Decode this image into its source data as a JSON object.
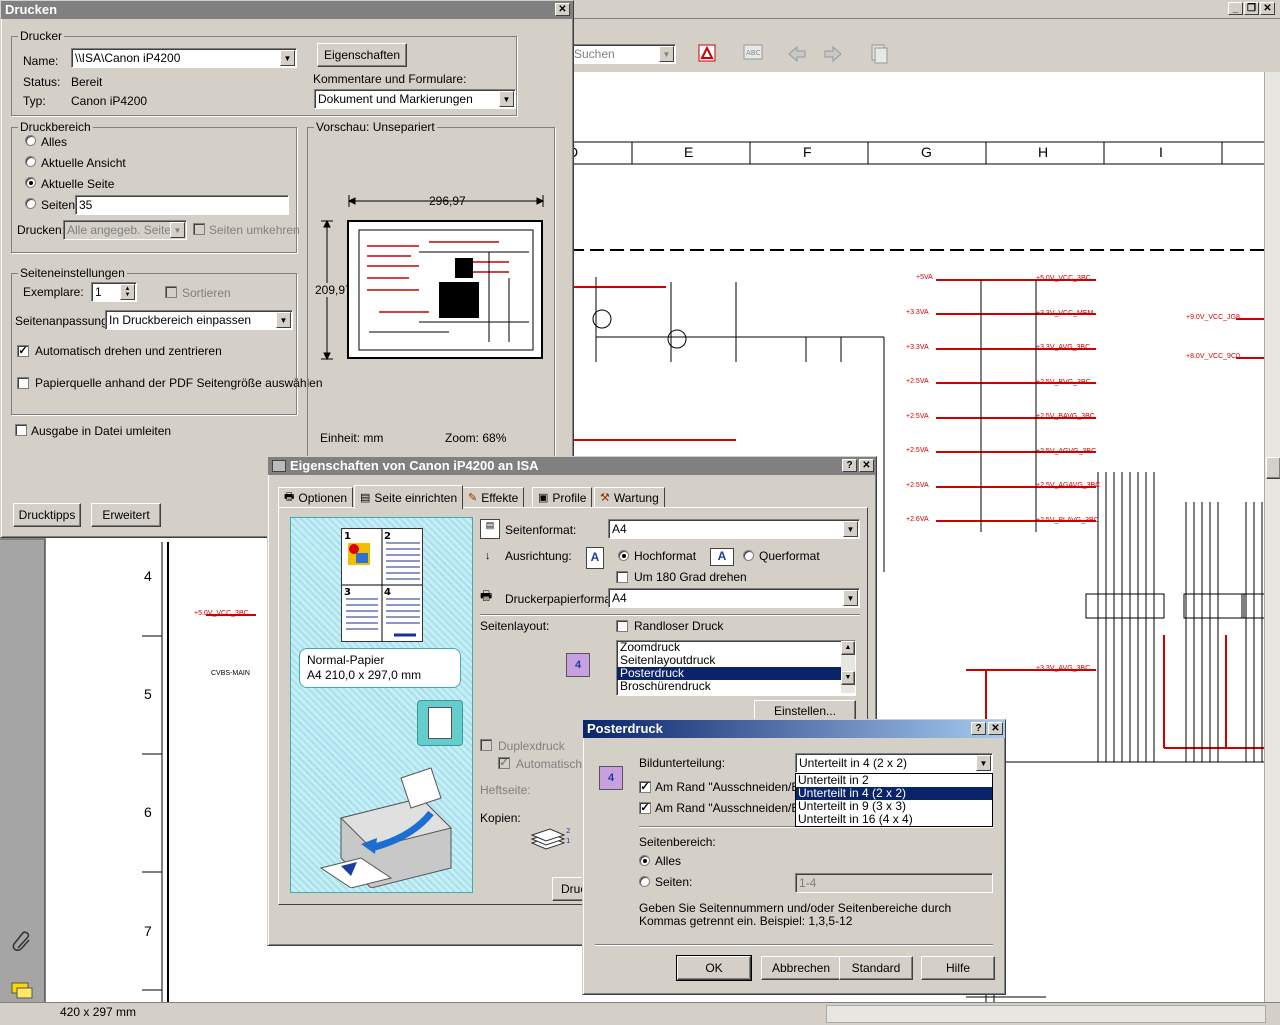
{
  "app": {
    "search_placeholder": "Suchen",
    "page_size": "420 x 297 mm",
    "window_buttons": [
      "_",
      "❐",
      "✕"
    ],
    "schematic": {
      "columns": [
        "D",
        "E",
        "F",
        "G",
        "H",
        "I"
      ],
      "rows": [
        "4",
        "5",
        "6",
        "7"
      ],
      "net_labels": [
        "+5.0V_VCC_3BC",
        "+3.3V_VCC_MEM",
        "+3.3V_AVG_3BC",
        "+2.5V_BVG_3BC",
        "+2.5V_BAVG_3BC",
        "+2.5V_AGVG_3BC",
        "+2.5V_AGAVG_3BC",
        "+2.5V_PLAVG_3BC"
      ],
      "rail_labels": [
        "+5VA",
        "+3.3VA",
        "+3.3VA",
        "+2.5VA",
        "+2.5VA",
        "+2.5VA",
        "+2.5VA",
        "+2.6VA"
      ],
      "misc_labels": [
        "+5.0V_VCC_3BC",
        "CVBS-MAIN",
        "+9.0V_VCC_JG8",
        "+8.0V_VCC_9C0",
        "+3.3V_AVG_3BC"
      ]
    }
  },
  "print_dialog": {
    "title": "Drucken",
    "printer_group": "Drucker",
    "name_label": "Name:",
    "name_value": "\\\\ISA\\Canon iP4200",
    "properties_button": "Eigenschaften",
    "status_label": "Status:",
    "status_value": "Bereit",
    "type_label": "Typ:",
    "type_value": "Canon iP4200",
    "comments_label": "Kommentare und Formulare:",
    "comments_value": "Dokument und Markierungen",
    "range_group": "Druckbereich",
    "range_all": "Alles",
    "range_view": "Aktuelle Ansicht",
    "range_page": "Aktuelle Seite",
    "range_pages": "Seiten",
    "range_pages_value": "35",
    "print_label": "Drucken:",
    "print_value": "Alle angegeb. Seiten",
    "reverse_label": "Seiten umkehren",
    "page_group": "Seiteneinstellungen",
    "copies_label": "Exemplare:",
    "copies_value": "1",
    "collate_label": "Sortieren",
    "scaling_label": "Seitenanpassung:",
    "scaling_value": "In Druckbereich einpassen",
    "autorotate_label": "Automatisch drehen und zentrieren",
    "papersource_label": "Papierquelle anhand der PDF Seitengröße auswählen",
    "print_to_file_label": "Ausgabe in Datei umleiten",
    "preview_group": "Vorschau: Unsepariert",
    "preview_width": "296,97",
    "preview_height": "209,97",
    "unit_label": "Einheit: mm",
    "zoom_label": "Zoom:  68%",
    "tips_button": "Drucktipps",
    "advanced_button": "Erweitert"
  },
  "props_dialog": {
    "title": "Eigenschaften von Canon iP4200 an ISA",
    "tabs": [
      "Optionen",
      "Seite einrichten",
      "Effekte",
      "Profile",
      "Wartung"
    ],
    "paper_type": "Normal-Papier",
    "paper_size": "A4 210,0 x 297,0 mm",
    "format_label": "Seitenformat:",
    "format_value": "A4",
    "orientation_label": "Ausrichtung:",
    "portrait_label": "Hochformat",
    "landscape_label": "Querformat",
    "rotate_label": "Um 180 Grad drehen",
    "printer_paper_label": "Druckerpapierformat:",
    "printer_paper_value": "A4",
    "layout_label": "Seitenlayout:",
    "borderless_label": "Randloser Druck",
    "layout_options": [
      "Zoomdruck",
      "Seitenlayoutdruck",
      "Posterdruck",
      "Broschürendruck"
    ],
    "layout_selected": "Posterdruck",
    "settings_button": "Einstellen...",
    "duplex_label": "Duplexdruck",
    "auto_label": "Automatisch",
    "stapling_label": "Heftseite:",
    "copies_label": "Kopien:",
    "print_button_partial": "Druc"
  },
  "poster_dialog": {
    "title": "Posterdruck",
    "division_label": "Bildunterteilung:",
    "division_value": "Unterteilt in 4 (2 x 2)",
    "division_options": [
      "Unterteilt in 2",
      "Unterteilt in 4 (2 x 2)",
      "Unterteilt in 9 (3 x 3)",
      "Unterteilt in 16 (4 x 4)"
    ],
    "division_selected": "Unterteilt in 4 (2 x 2)",
    "cut_label_1": "Am Rand \"Ausschneiden/Ein",
    "cut_label_2": "Am Rand \"Ausschneiden/Ein",
    "range_label": "Seitenbereich:",
    "range_all": "Alles",
    "range_pages": "Seiten:",
    "range_pages_value": "1-4",
    "hint": "Geben Sie Seitennummern und/oder Seitenbereiche durch Kommas getrennt ein. Beispiel: 1,3,5-12",
    "ok_button": "OK",
    "cancel_button": "Abbrechen",
    "default_button": "Standard",
    "help_button": "Hilfe"
  }
}
